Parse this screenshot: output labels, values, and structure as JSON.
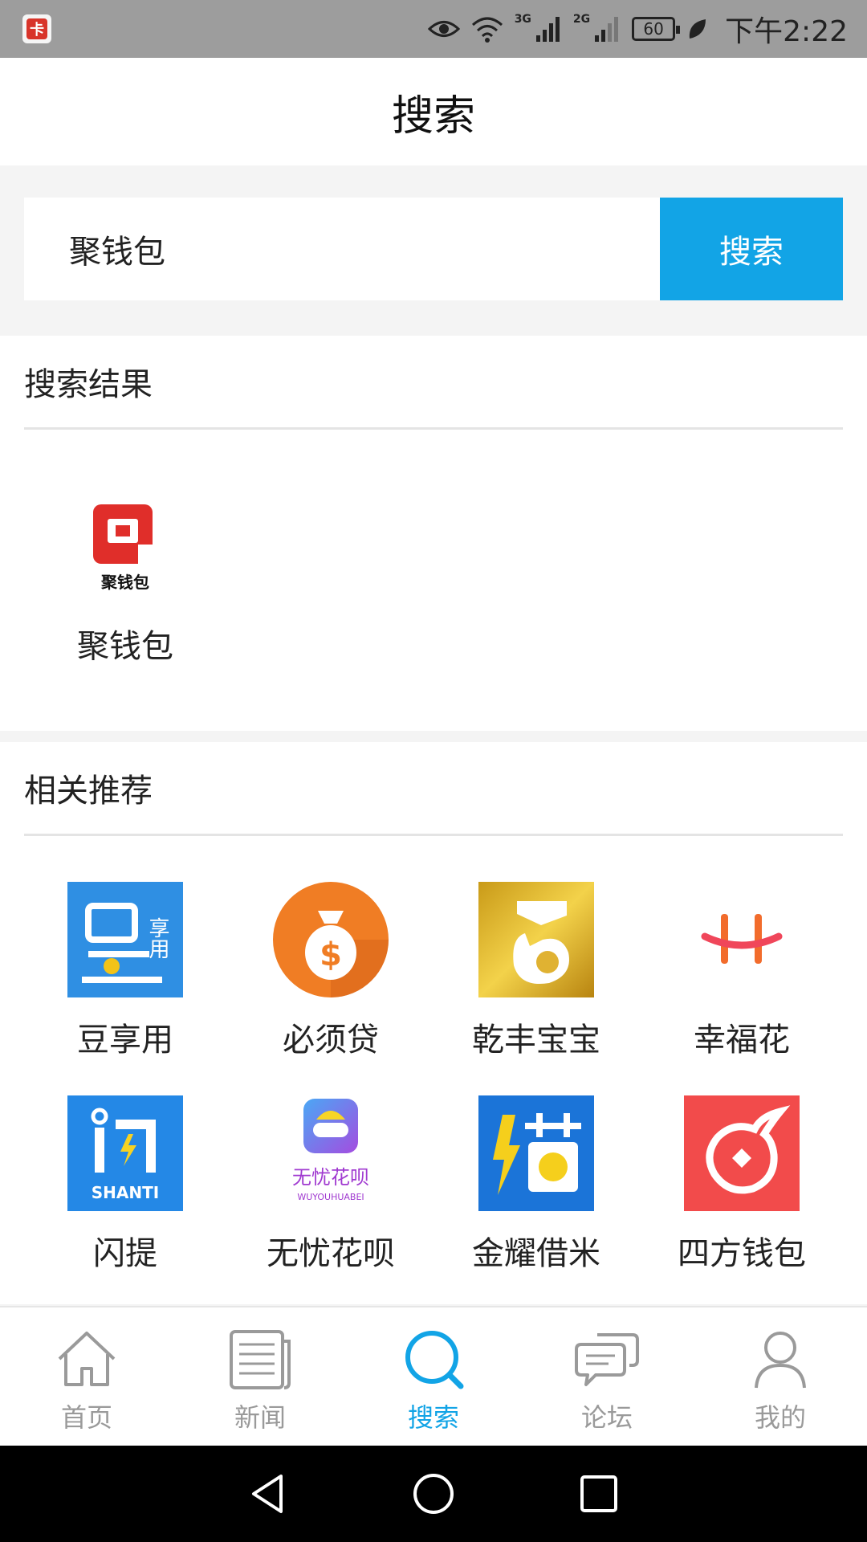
{
  "status_bar": {
    "net1": "3G",
    "net2": "2G",
    "battery": "60",
    "time": "下午2:22"
  },
  "header": {
    "title": "搜索"
  },
  "search": {
    "value": "聚钱包",
    "button_label": "搜索"
  },
  "results": {
    "title": "搜索结果",
    "items": [
      {
        "label": "聚钱包",
        "icon": "juqianbao-app-icon",
        "icon_text": "聚钱包"
      }
    ]
  },
  "recommend": {
    "title": "相关推荐",
    "items": [
      {
        "label": "豆享用",
        "icon": "douxiangyong-app-icon",
        "icon_text": "享用"
      },
      {
        "label": "必须贷",
        "icon": "bixudai-app-icon",
        "icon_text": "$"
      },
      {
        "label": "乾丰宝宝",
        "icon": "qianfengbaobao-app-icon"
      },
      {
        "label": "幸福花",
        "icon": "xingfuhua-app-icon"
      },
      {
        "label": "闪提",
        "icon": "shanti-app-icon",
        "icon_text": "SHANTI"
      },
      {
        "label": "无忧花呗",
        "icon": "wuyouhuabei-app-icon",
        "icon_text": "无忧花呗",
        "icon_subtext": "WUYOUHUABEI"
      },
      {
        "label": "金耀借米",
        "icon": "jinyaojiemi-app-icon"
      },
      {
        "label": "四方钱包",
        "icon": "sifangqianbao-app-icon"
      }
    ]
  },
  "tabs": [
    {
      "label": "首页",
      "icon": "home-icon",
      "active": false
    },
    {
      "label": "新闻",
      "icon": "news-icon",
      "active": false
    },
    {
      "label": "搜索",
      "icon": "search-icon",
      "active": true
    },
    {
      "label": "论坛",
      "icon": "forum-icon",
      "active": false
    },
    {
      "label": "我的",
      "icon": "profile-icon",
      "active": false
    }
  ],
  "colors": {
    "accent": "#12a4e6",
    "inactive": "#9a9a9a"
  }
}
